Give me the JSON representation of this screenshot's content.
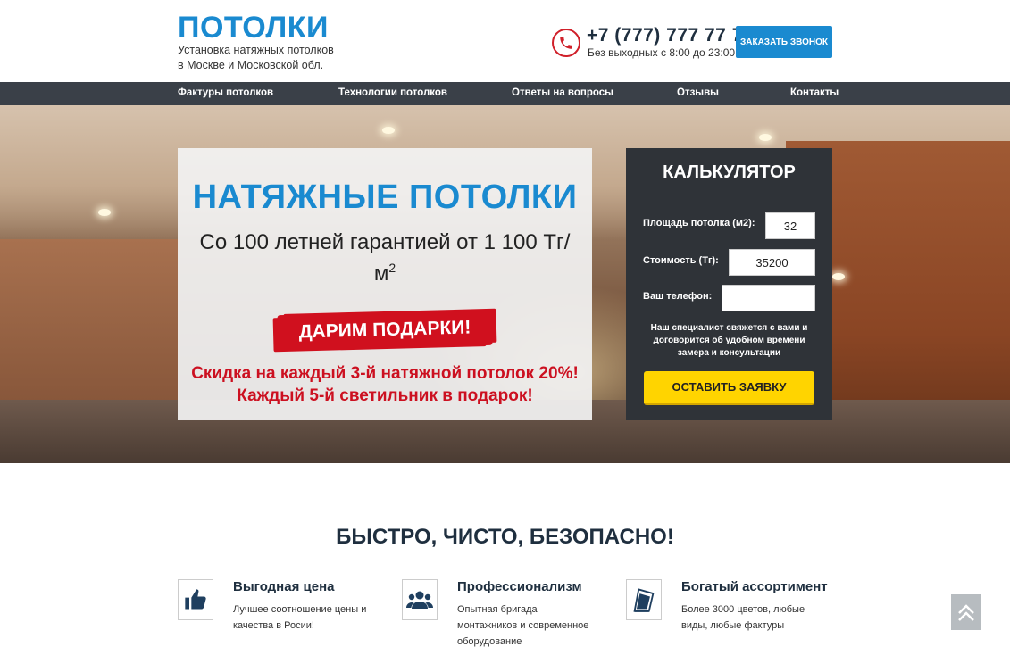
{
  "header": {
    "logo": "ПОТОЛКИ",
    "tagline_line1": "Установка натяжных потолков",
    "tagline_line2": "в Москве и Московской обл.",
    "phone": "+7 (777) 777 77 77",
    "hours": "Без выходных с 8:00 до 23:00",
    "callback_label": "ЗАКАЗАТЬ ЗВОНОК"
  },
  "nav": {
    "items": [
      {
        "label": "Фактуры потолков"
      },
      {
        "label": "Технологии потолков"
      },
      {
        "label": "Ответы на вопросы"
      },
      {
        "label": "Отзывы"
      },
      {
        "label": "Контакты"
      }
    ]
  },
  "offer": {
    "title": "НАТЯЖНЫЕ ПОТОЛКИ",
    "subtitle_line1": "Со 100 летней гарантией от 1 100 Тг/",
    "subtitle_line2": "м",
    "subtitle_sup": "2",
    "gift": "ДАРИМ ПОДАРКИ!",
    "promo_line1": "Скидка на каждый 3-й натяжной потолок 20%!",
    "promo_line2": "Каждый 5-й светильник в подарок!"
  },
  "calculator": {
    "title": "КАЛЬКУЛЯТОР",
    "area_label": "Площадь потолка (м2):",
    "area_value": "32",
    "cost_label": "Стоимость (Тг):",
    "cost_value": "35200",
    "phone_label": "Ваш телефон:",
    "phone_value": "",
    "note": "Наш специалист свяжется с вами и договорится об удобном времени замера и консультации",
    "submit_label": "ОСТАВИТЬ ЗАЯВКУ"
  },
  "features": {
    "title": "БЫСТРО, ЧИСТО, БЕЗОПАСНО!",
    "items": [
      {
        "icon": "thumbs-up-icon",
        "title": "Выгодная цена",
        "text_line1": "Лучшее соотношение цены и",
        "text_line2": "качества в Росии!",
        "text_line3": ""
      },
      {
        "icon": "users-icon",
        "title": "Профессионализм",
        "text_line1": "Опытная бригада",
        "text_line2": "монтажников и современное",
        "text_line3": "оборудование"
      },
      {
        "icon": "swatches-icon",
        "title": "Богатый ассортимент",
        "text_line1": "Более 3000 цветов, любые",
        "text_line2": "виды, любые фактуры",
        "text_line3": ""
      }
    ]
  },
  "colors": {
    "brand_blue": "#1a8ad0",
    "accent_red": "#d0101e",
    "button_yellow": "#ffd400",
    "nav_dark": "#3a4048"
  }
}
